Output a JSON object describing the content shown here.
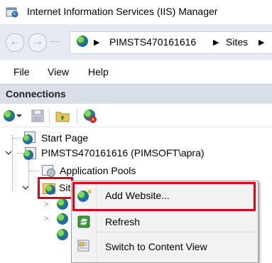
{
  "window": {
    "title": "Internet Information Services (IIS) Manager",
    "icon": "iis-manager-icon"
  },
  "address_bar": {
    "back_icon": "back-arrow-icon",
    "forward_icon": "forward-arrow-icon",
    "breadcrumbs": [
      "PIMSTS470161616",
      "Sites"
    ],
    "separator": "▶"
  },
  "menu": {
    "items": [
      "File",
      "View",
      "Help"
    ]
  },
  "connections": {
    "title": "Connections",
    "toolbar_icons": [
      "connect-icon",
      "save-icon",
      "up-folder-icon",
      "disconnect-icon"
    ]
  },
  "tree": {
    "start_page": "Start Page",
    "server": "PIMSTS470161616 (PIMSOFT\\apra)",
    "app_pools": "Application Pools",
    "sites": "Sites"
  },
  "context_menu": {
    "items": [
      {
        "label": "Add Website...",
        "icon": "add-website-icon",
        "highlighted": true
      },
      {
        "label": "Refresh",
        "icon": "refresh-icon",
        "highlighted": false
      },
      {
        "label": "Switch to Content View",
        "icon": "content-view-icon",
        "highlighted": false
      }
    ]
  },
  "colors": {
    "highlight_border": "#e0001a",
    "header_bg": "#d8dfe8",
    "address_bg": "#e6ebf3"
  }
}
